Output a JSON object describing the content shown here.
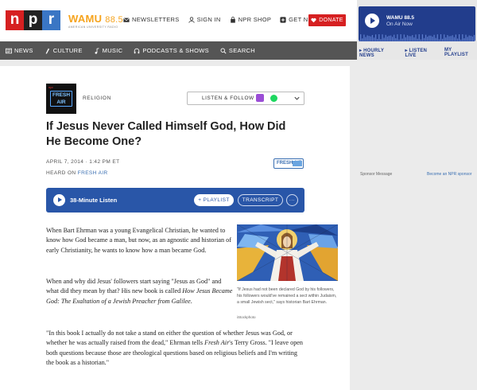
{
  "header": {
    "logo_letters": [
      "n",
      "p",
      "r"
    ],
    "station_name": "WAMU",
    "station_freq": "88.5",
    "station_sub": "AMERICAN UNIVERSITY RADIO",
    "links": [
      {
        "label": "NEWSLETTERS",
        "icon": "envelope-icon"
      },
      {
        "label": "SIGN IN",
        "icon": "user-icon"
      },
      {
        "label": "NPR SHOP",
        "icon": "bag-icon"
      },
      {
        "label": "GET NPR+",
        "icon": "plus-icon"
      }
    ],
    "donate_label": "DONATE"
  },
  "nav": {
    "items": [
      {
        "label": "NEWS",
        "icon": "newspaper-icon"
      },
      {
        "label": "CULTURE",
        "icon": "culture-icon"
      },
      {
        "label": "MUSIC",
        "icon": "music-note-icon"
      },
      {
        "label": "PODCASTS & SHOWS",
        "icon": "headphones-icon"
      },
      {
        "label": "SEARCH",
        "icon": "search-icon"
      }
    ]
  },
  "player": {
    "station": "WAMU 88.5",
    "status": "On Air Now",
    "links": [
      "HOURLY NEWS",
      "LISTEN LIVE",
      "MY PLAYLIST"
    ]
  },
  "sponsor": {
    "label": "Sponsor Message",
    "link": "Become an NPR sponsor"
  },
  "article": {
    "thumb_text": "FRESH AIR",
    "category": "RELIGION",
    "listen_follow": "LISTEN & FOLLOW",
    "title": "If Jesus Never Called Himself God, How Did He Become One?",
    "date": "APRIL 7, 2014 · 1:42 PM ET",
    "heard_on_prefix": "HEARD ON",
    "heard_on_show": "FRESH AIR",
    "show_logo": "FRESH AIR",
    "audio": {
      "label": "38-Minute Listen",
      "playlist_label": "+ PLAYLIST",
      "transcript_label": "TRANSCRIPT",
      "more_label": "···"
    },
    "paragraphs": [
      "When Bart Ehrman was a young Evangelical Christian, he wanted to know how God became a man, but now, as an agnostic and historian of early Christianity, he wants to know how a man became God.",
      "When and why did Jesus' followers start saying \"Jesus as God\" and what did they mean by that? His new book is called",
      "\"In this book I actually do not take a stand on either the question of whether Jesus was God, or whether he was actually raised from the dead,\" Ehrman tells"
    ],
    "book_title": "How Jesus Became God: The Exaltation of a Jewish Preacher from Galilee",
    "p2_end": ".",
    "show_italic": "Fresh Air",
    "p3_end": "'s Terry Gross. \"I leave open both questions because those are theological questions based on religious beliefs and I'm writing the book as a historian.\"",
    "caption": "\"If Jesus had not been declared God by his followers, his followers would've remained a sect within Judaism, a small Jewish sect,\" says historian Bart Ehrman.",
    "credit": "iStockphoto"
  },
  "colors": {
    "npr_red": "#d62021",
    "npr_blue": "#3a76c4",
    "wamu_orange": "#f6a41e",
    "player_blue": "#223d8c",
    "audio_blue": "#2956a8",
    "nav_gray": "#555555"
  }
}
